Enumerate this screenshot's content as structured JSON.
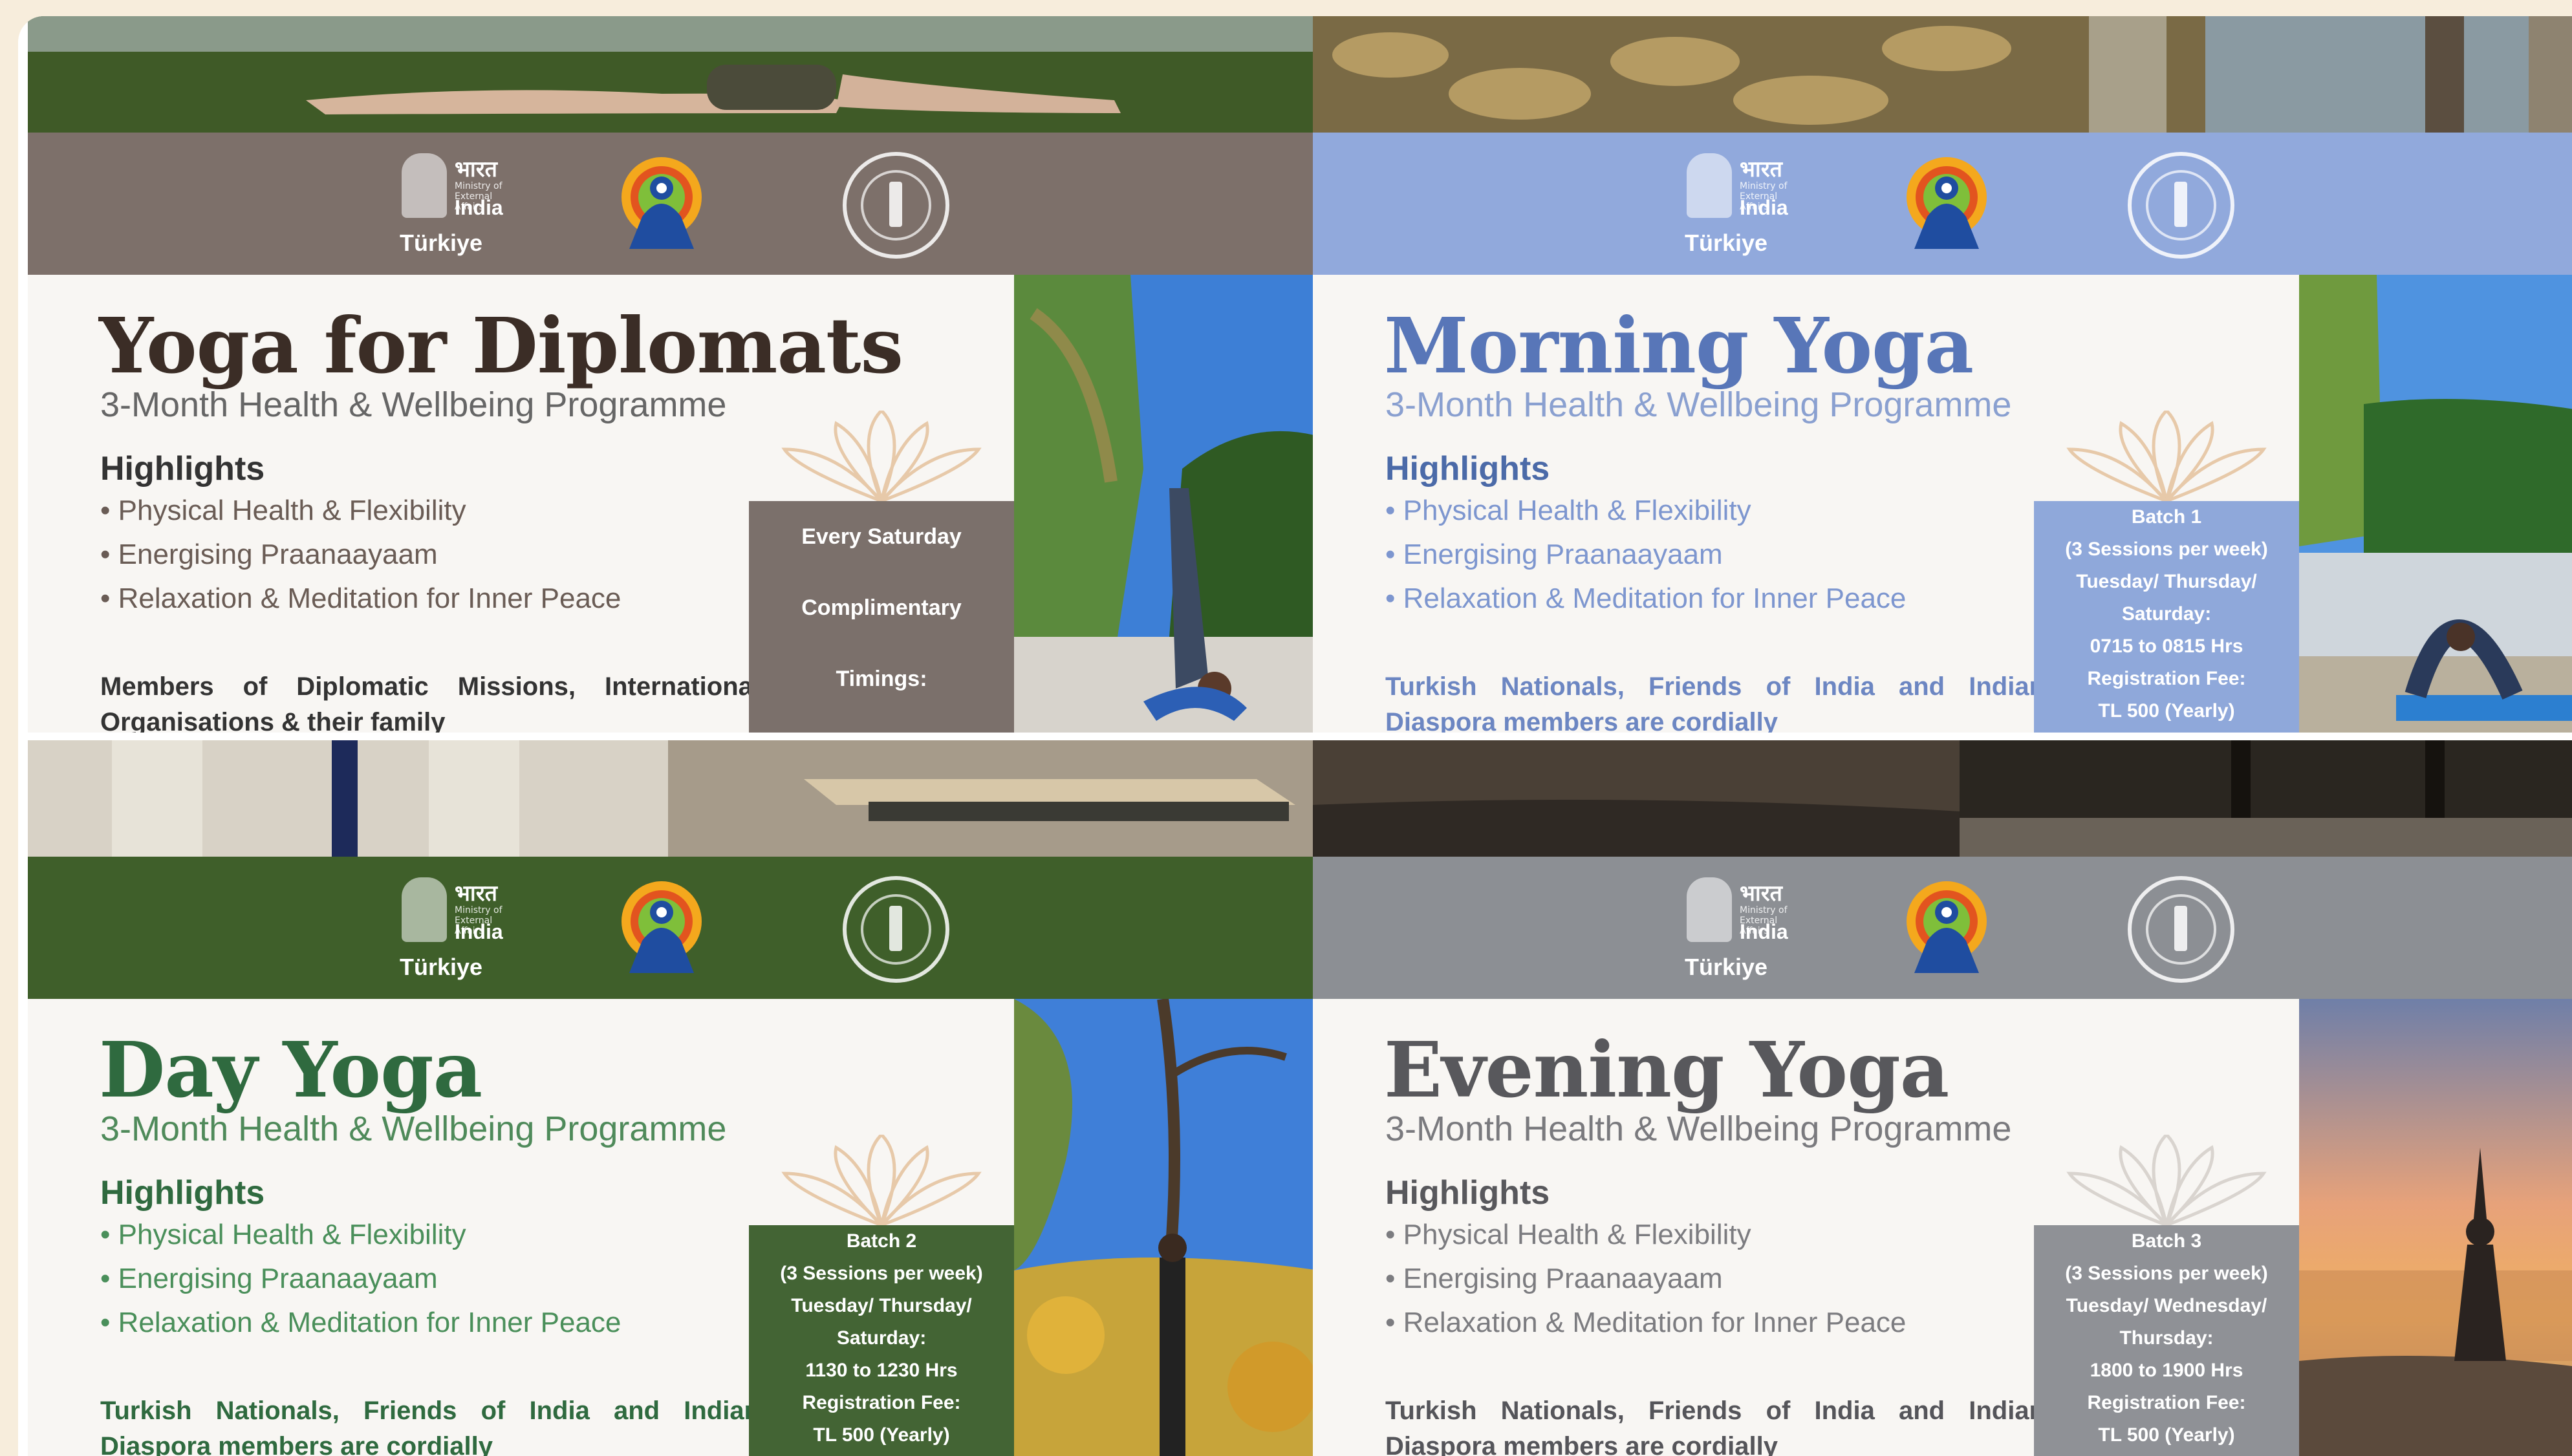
{
  "logos": {
    "ministry_hindi": "भारत",
    "ministry_sub": "Ministry of External Affairs",
    "ministry_india": "India",
    "country": "Türkiye"
  },
  "panels": {
    "diplomats": {
      "title": "Yoga for Diplomats",
      "subtitle": "3-Month Health & Wellbeing Programme",
      "highlights_heading": "Highlights",
      "highlights": [
        "• Physical Health & Flexibility",
        "• Energising Praanaayaam",
        "• Relaxation & Meditation for Inner Peace"
      ],
      "audience": "Members of Diplomatic Missions, International Organisations & their family",
      "info": [
        "Every Saturday",
        "Complimentary",
        "Timings:"
      ],
      "band_color": "#7d706a",
      "accent_color": "#3b2d26",
      "box_color": "#7b706b"
    },
    "morning": {
      "title": "Morning Yoga",
      "subtitle": "3-Month Health & Wellbeing Programme",
      "highlights_heading": "Highlights",
      "highlights": [
        "• Physical Health & Flexibility",
        "• Energising Praanaayaam",
        "• Relaxation & Meditation for Inner Peace"
      ],
      "audience": "Turkish Nationals, Friends of India and Indian Diaspora members are cordially",
      "info": [
        "Batch 1",
        "(3 Sessions per week)",
        "Tuesday/ Thursday/",
        "Saturday:",
        "0715 to 0815 Hrs",
        "",
        "Registration Fee:",
        "TL 500 (Yearly)"
      ],
      "band_color": "#91a9dc",
      "accent_color": "#5876b8",
      "box_color": "#8fa8da"
    },
    "day": {
      "title": "Day Yoga",
      "subtitle": "3-Month Health & Wellbeing Programme",
      "highlights_heading": "Highlights",
      "highlights": [
        "• Physical Health & Flexibility",
        "• Energising Praanaayaam",
        "• Relaxation & Meditation for Inner Peace"
      ],
      "audience": "Turkish Nationals, Friends of India and Indian Diaspora members are cordially",
      "info": [
        "Batch 2",
        "(3 Sessions per week)",
        "Tuesday/ Thursday/",
        "Saturday:",
        "1130 to 1230 Hrs",
        "",
        "Registration Fee:",
        "TL 500 (Yearly)"
      ],
      "band_color": "#3f5f2a",
      "accent_color": "#2f6a3f",
      "box_color": "#436434"
    },
    "evening": {
      "title": "Evening Yoga",
      "subtitle": "3-Month Health & Wellbeing Programme",
      "highlights_heading": "Highlights",
      "highlights": [
        "• Physical Health & Flexibility",
        "• Energising Praanaayaam",
        "• Relaxation & Meditation for Inner Peace"
      ],
      "audience": "Turkish Nationals, Friends of India and Indian Diaspora members are cordially",
      "info": [
        "Batch 3",
        "(3 Sessions per week)",
        "Tuesday/ Wednesday/",
        "Thursday:",
        "1800 to 1900 Hrs",
        "",
        "Registration Fee:",
        "TL 500 (Yearly)"
      ],
      "band_color": "#8c8f94",
      "accent_color": "#58585c",
      "box_color": "#8f9196"
    }
  }
}
